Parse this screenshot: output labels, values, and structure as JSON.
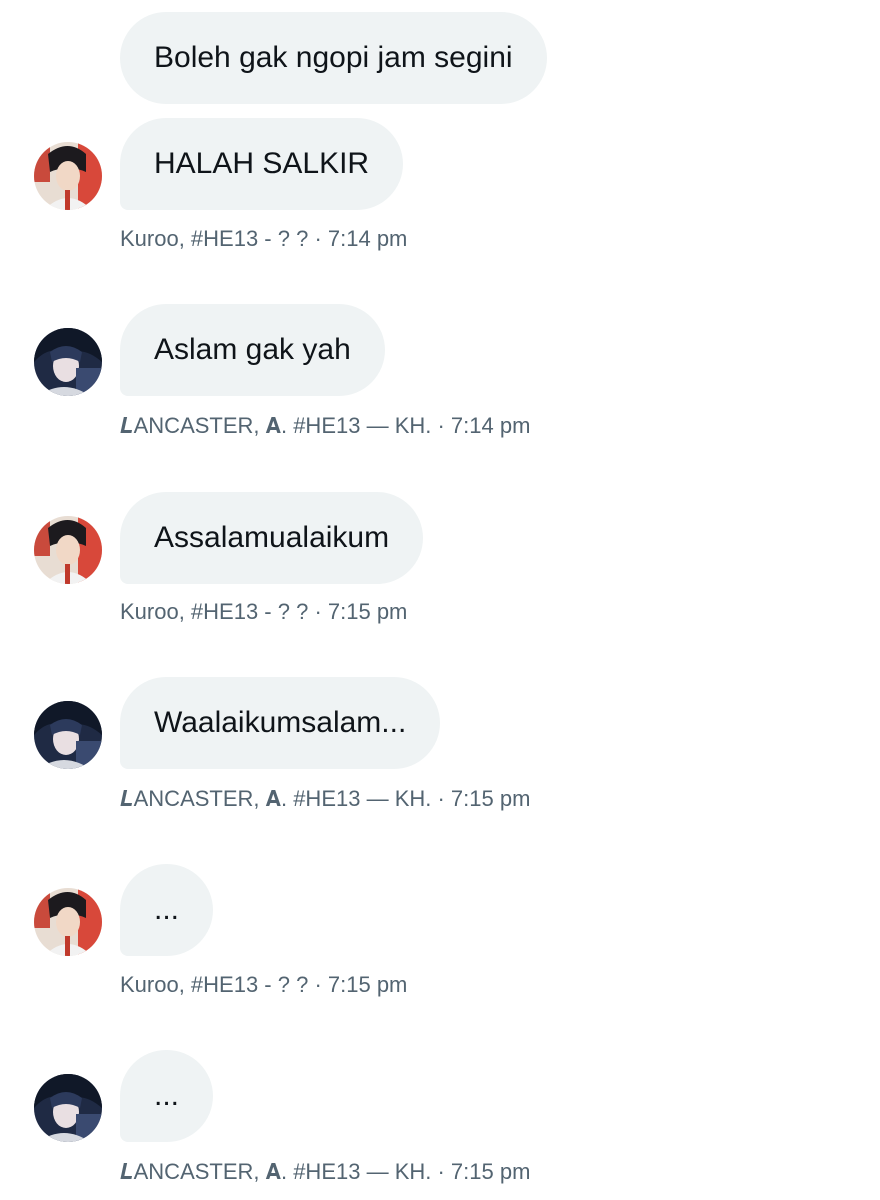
{
  "messages": [
    {
      "text": "Boleh gak ngopi jam segini"
    },
    {
      "text": "HALAH SALKIR",
      "meta": "Kuroo, #HE13 - ? ? · 7:14 pm",
      "avatar": "kuroo-avatar"
    },
    {
      "text": "Aslam gak yah",
      "meta": "𝑳ANCASTER, 𝐀. #HE13 — KH. · 7:14 pm",
      "avatar": "lancaster-avatar"
    },
    {
      "text": "Assalamualaikum",
      "meta": "Kuroo, #HE13 - ? ? · 7:15 pm",
      "avatar": "kuroo-avatar"
    },
    {
      "text": "Waalaikumsalam...",
      "meta": "𝑳ANCASTER, 𝐀. #HE13 — KH. · 7:15 pm",
      "avatar": "lancaster-avatar"
    },
    {
      "text": "...",
      "meta": "Kuroo, #HE13 - ? ? · 7:15 pm",
      "avatar": "kuroo-avatar"
    },
    {
      "text": "...",
      "meta": "𝑳ANCASTER, 𝐀. #HE13 — KH. · 7:15 pm",
      "avatar": "lancaster-avatar"
    }
  ],
  "colors": {
    "bubble_bg": "#eff3f4",
    "text": "#0f1419",
    "meta": "#536471"
  }
}
